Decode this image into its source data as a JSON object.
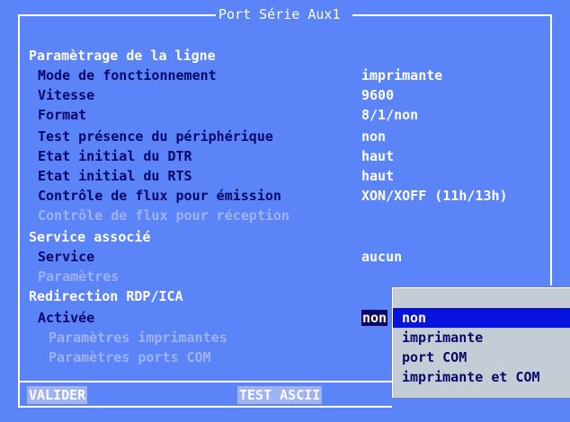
{
  "window": {
    "title": "Port Série Aux1"
  },
  "sections": {
    "line": "Paramètrage de la ligne",
    "service": "Service associé",
    "redirect": "Redirection RDP/ICA"
  },
  "rows": [
    {
      "label": "Mode de fonctionnement",
      "value": "imprimante",
      "disabled": false
    },
    {
      "label": "Vitesse",
      "value": "9600",
      "disabled": false
    },
    {
      "label": "Format",
      "value": "8/1/non",
      "disabled": false
    },
    {
      "label": "Test présence du périphérique",
      "value": "non",
      "disabled": false
    },
    {
      "label": "Etat initial du DTR",
      "value": "haut",
      "disabled": false
    },
    {
      "label": "Etat initial du RTS",
      "value": "haut",
      "disabled": false
    },
    {
      "label": "Contrôle de flux pour émission",
      "value": "XON/XOFF (11h/13h)",
      "disabled": false
    },
    {
      "label": "Contrôle de flux pour réception",
      "value": "",
      "disabled": true
    }
  ],
  "service": {
    "label": "Service",
    "value": "aucun",
    "params_label": "Paramètres"
  },
  "redirect": {
    "active_label": "Activée",
    "active_value": "non",
    "printer_params": "Paramètres imprimantes",
    "com_params": "Paramètres ports COM"
  },
  "dropdown": {
    "options": [
      "non",
      "imprimante",
      "port COM",
      "imprimante et COM"
    ],
    "selected": "non"
  },
  "buttons": {
    "validate": "VALIDER",
    "test": "TEST ASCII"
  },
  "colors": {
    "background": "#5b84f8",
    "label": "#08086a",
    "disabled": "#9fb2f1",
    "highlight": "#0812de",
    "popup": "#c4cdd6"
  }
}
